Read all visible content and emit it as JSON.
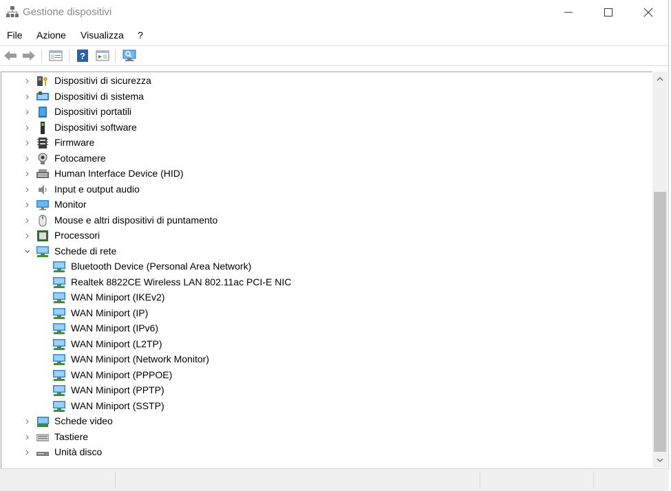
{
  "window": {
    "title": "Gestione dispositivi",
    "icon": "device-manager-icon",
    "controls": {
      "minimize": "minimize-icon",
      "maximize": "maximize-icon",
      "close": "close-icon"
    }
  },
  "menubar": {
    "items": [
      {
        "label": "File"
      },
      {
        "label": "Azione"
      },
      {
        "label": "Visualizza"
      },
      {
        "label": "?"
      }
    ]
  },
  "toolbar": {
    "buttons": [
      "back-arrow-icon",
      "forward-arrow-icon",
      "properties-icon",
      "help-icon",
      "update-driver-icon",
      "scan-hardware-icon"
    ]
  },
  "tree": {
    "items": [
      {
        "label": "Dispositivi di sicurezza",
        "icon": "security-device-icon",
        "level": 0,
        "expanded": false
      },
      {
        "label": "Dispositivi di sistema",
        "icon": "system-device-icon",
        "level": 0,
        "expanded": false
      },
      {
        "label": "Dispositivi portatili",
        "icon": "portable-device-icon",
        "level": 0,
        "expanded": false
      },
      {
        "label": "Dispositivi software",
        "icon": "software-device-icon",
        "level": 0,
        "expanded": false
      },
      {
        "label": "Firmware",
        "icon": "firmware-icon",
        "level": 0,
        "expanded": false
      },
      {
        "label": "Fotocamere",
        "icon": "camera-icon",
        "level": 0,
        "expanded": false
      },
      {
        "label": "Human Interface Device (HID)",
        "icon": "hid-icon",
        "level": 0,
        "expanded": false
      },
      {
        "label": "Input e output audio",
        "icon": "speaker-icon",
        "level": 0,
        "expanded": false
      },
      {
        "label": "Monitor",
        "icon": "monitor-icon",
        "level": 0,
        "expanded": false
      },
      {
        "label": "Mouse e altri dispositivi di puntamento",
        "icon": "mouse-icon",
        "level": 0,
        "expanded": false
      },
      {
        "label": "Processori",
        "icon": "processor-icon",
        "level": 0,
        "expanded": false
      },
      {
        "label": "Schede di rete",
        "icon": "network-adapter-icon",
        "level": 0,
        "expanded": true
      },
      {
        "label": "Bluetooth Device (Personal Area Network)",
        "icon": "network-adapter-icon",
        "level": 1
      },
      {
        "label": "Realtek 8822CE Wireless LAN 802.11ac PCI-E NIC",
        "icon": "network-adapter-icon",
        "level": 1
      },
      {
        "label": "WAN Miniport (IKEv2)",
        "icon": "network-adapter-icon",
        "level": 1
      },
      {
        "label": "WAN Miniport (IP)",
        "icon": "network-adapter-icon",
        "level": 1
      },
      {
        "label": "WAN Miniport (IPv6)",
        "icon": "network-adapter-icon",
        "level": 1
      },
      {
        "label": "WAN Miniport (L2TP)",
        "icon": "network-adapter-icon",
        "level": 1
      },
      {
        "label": "WAN Miniport (Network Monitor)",
        "icon": "network-adapter-icon",
        "level": 1
      },
      {
        "label": "WAN Miniport (PPPOE)",
        "icon": "network-adapter-icon",
        "level": 1
      },
      {
        "label": "WAN Miniport (PPTP)",
        "icon": "network-adapter-icon",
        "level": 1
      },
      {
        "label": "WAN Miniport (SSTP)",
        "icon": "network-adapter-icon",
        "level": 1
      },
      {
        "label": "Schede video",
        "icon": "display-adapter-icon",
        "level": 0,
        "expanded": false
      },
      {
        "label": "Tastiere",
        "icon": "keyboard-icon",
        "level": 0,
        "expanded": false
      },
      {
        "label": "Unità disco",
        "icon": "disk-drive-icon",
        "level": 0,
        "expanded": false
      }
    ]
  },
  "colors": {
    "title_text": "#8a8a8a",
    "icon_blue": "#2e8ad8",
    "scrollbar_thumb": "#c2c2c2"
  }
}
